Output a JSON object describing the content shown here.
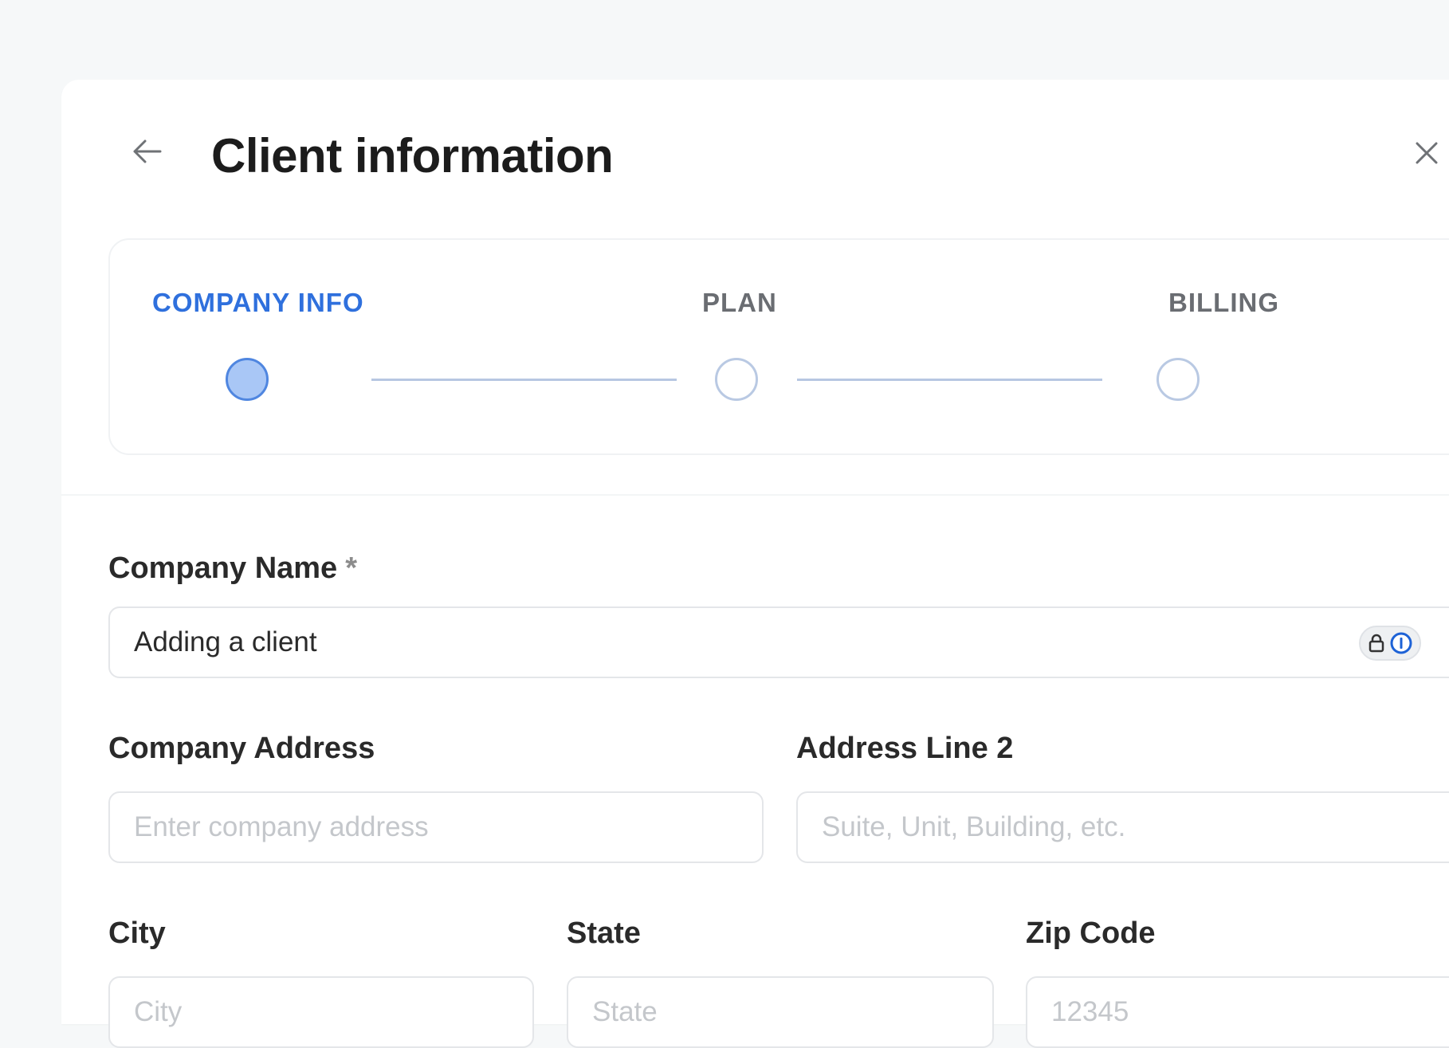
{
  "header": {
    "title": "Client information"
  },
  "stepper": {
    "steps": [
      {
        "label": "COMPANY INFO",
        "state": "active"
      },
      {
        "label": "PLAN",
        "state": "inactive"
      },
      {
        "label": "BILLING",
        "state": "inactive"
      }
    ],
    "colors": {
      "active": "#2f70dd",
      "inactive": "#6a6d72"
    }
  },
  "form": {
    "company_name": {
      "label": "Company Name",
      "required_mark": "*",
      "value": "Adding a client"
    },
    "company_address": {
      "label": "Company Address",
      "placeholder": "Enter company address"
    },
    "address_line2": {
      "label": "Address Line 2",
      "placeholder": "Suite, Unit, Building, etc."
    },
    "city": {
      "label": "City",
      "placeholder": "City"
    },
    "state": {
      "label": "State",
      "placeholder": "State"
    },
    "zip": {
      "label": "Zip Code",
      "placeholder": "12345"
    }
  },
  "icons": {
    "back": "arrow-left-icon",
    "close": "close-icon",
    "password_manager": "password-manager-icon"
  }
}
